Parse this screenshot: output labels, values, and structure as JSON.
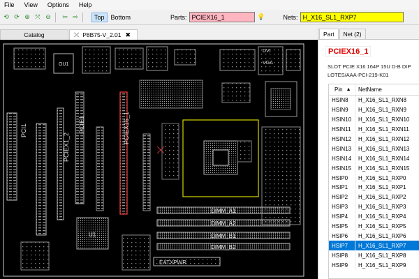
{
  "menu": [
    "File",
    "View",
    "Options",
    "Help"
  ],
  "toolbar": {
    "side_top": "Top",
    "side_bottom": "Bottom",
    "parts_label": "Parts:",
    "parts_value": "PCIEX16_1",
    "nets_label": "Nets:",
    "nets_value": "H_X16_SL1_RXP7"
  },
  "tabs": {
    "catalog": "Catalog",
    "board": "P8B75-V_2.01"
  },
  "board": {
    "labels": {
      "ou1": "OU1",
      "dvi": "DVI",
      "vga": "VGA",
      "pci1": "PCI1",
      "pciex1_2": "PCIEX1_2",
      "pcie1": "PCIE1",
      "pciex16_1": "PCIEX16_1",
      "dimm_a1": "DIMM_A1",
      "dimm_a2": "DIMM_A2",
      "dimm_b1": "DIMM_B1",
      "dimm_b2": "DIMM_B2",
      "u1": "U1",
      "eatxpwr": "EATXPWR"
    }
  },
  "right": {
    "tab_part": "Part",
    "tab_net": "Net (2)",
    "part_name": "PCIEX16_1",
    "desc_line1": "SLOT PCIE X16 164P 15U D-B DIP",
    "desc_line2": "LOTES/AAA-PCI-219-K01",
    "col_pin": "Pin",
    "col_net": "NetName",
    "rows": [
      [
        "HSIN8",
        "H_X16_SL1_RXN8"
      ],
      [
        "HSIN9",
        "H_X16_SL1_RXN9"
      ],
      [
        "HSIN10",
        "H_X16_SL1_RXN10"
      ],
      [
        "HSIN11",
        "H_X16_SL1_RXN11"
      ],
      [
        "HSIN12",
        "H_X16_SL1_RXN12"
      ],
      [
        "HSIN13",
        "H_X16_SL1_RXN13"
      ],
      [
        "HSIN14",
        "H_X16_SL1_RXN14"
      ],
      [
        "HSIN15",
        "H_X16_SL1_RXN15"
      ],
      [
        "HSIP0",
        "H_X16_SL1_RXP0"
      ],
      [
        "HSIP1",
        "H_X16_SL1_RXP1"
      ],
      [
        "HSIP2",
        "H_X16_SL1_RXP2"
      ],
      [
        "HSIP3",
        "H_X16_SL1_RXP3"
      ],
      [
        "HSIP4",
        "H_X16_SL1_RXP4"
      ],
      [
        "HSIP5",
        "H_X16_SL1_RXP5"
      ],
      [
        "HSIP6",
        "H_X16_SL1_RXP6"
      ],
      [
        "HSIP7",
        "H_X16_SL1_RXP7"
      ],
      [
        "HSIP8",
        "H_X16_SL1_RXP8"
      ],
      [
        "HSIP9",
        "H_X16_SL1_RXP9"
      ]
    ],
    "selected_row": 15
  },
  "colors": {
    "part_field_bg": "#ffb6c1",
    "net_field_bg": "#ffff00",
    "selection": "#0078d7",
    "highlight_red": "#ff4040",
    "cpu_outline": "#d4d400"
  }
}
